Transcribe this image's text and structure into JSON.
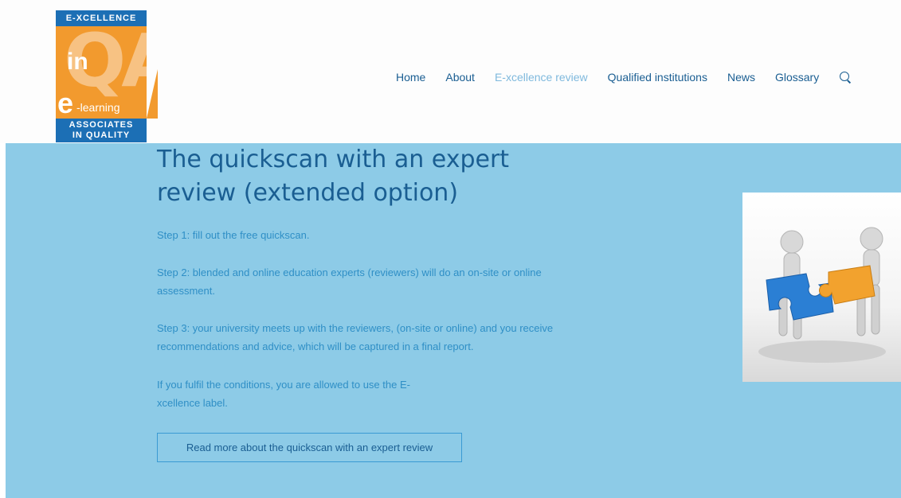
{
  "logo": {
    "top_text": "E-XCELLENCE",
    "in_text": "in",
    "qa_text": "QA",
    "e_text": "e",
    "learning_text": "-learning",
    "bottom_line1": "ASSOCIATES",
    "bottom_line2": "IN QUALITY"
  },
  "nav": {
    "items": [
      {
        "label": "Home"
      },
      {
        "label": "About"
      },
      {
        "label": "E-xcellence review",
        "active": true
      },
      {
        "label": "Qualified institutions"
      },
      {
        "label": "News"
      },
      {
        "label": "Glossary"
      }
    ],
    "search_icon": "search-icon"
  },
  "main": {
    "title": "The quickscan with an expert review (extended option)",
    "step1": "Step 1: fill out the free quickscan.",
    "step2": "Step 2: blended and online education experts (reviewers) will do an on-site or online assessment.",
    "step3": "Step 3: your university meets up with the reviewers, (on-site or online) and you receive recommendations and advice, which will be captured in a final report.",
    "conditions": "If you fulfil the conditions, you are allowed to use the E-xcellence label.",
    "button_label": "Read more about the quickscan with an expert review",
    "image_icon": "puzzle-figures-image"
  },
  "colors": {
    "band": "#8dcbe7",
    "title": "#1a5e92",
    "body_text": "#2f8fc6",
    "nav_active": "#7fb9dd",
    "logo_blue": "#1c6fb5",
    "logo_orange": "#f29a2e"
  }
}
